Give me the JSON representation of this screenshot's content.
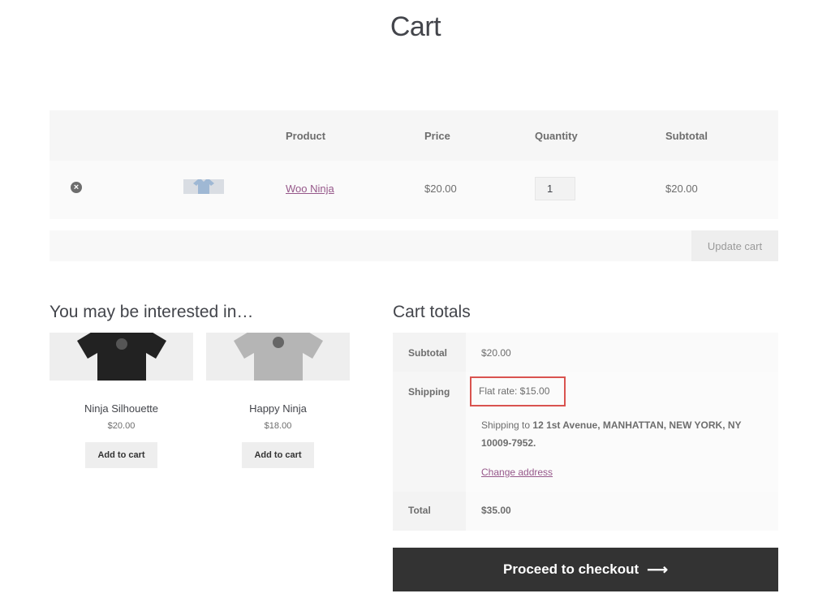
{
  "page": {
    "title": "Cart"
  },
  "cart_table": {
    "headers": {
      "product": "Product",
      "price": "Price",
      "quantity": "Quantity",
      "subtotal": "Subtotal"
    },
    "rows": [
      {
        "remove_icon": "close-circle-icon",
        "product": "Woo Ninja",
        "price": "$20.00",
        "quantity": "1",
        "subtotal": "$20.00"
      }
    ],
    "update_label": "Update cart"
  },
  "cross_sells": {
    "heading": "You may be interested in…",
    "products": [
      {
        "name": "Ninja Silhouette",
        "price": "$20.00",
        "button": "Add to cart",
        "shirt_color": "#222222"
      },
      {
        "name": "Happy Ninja",
        "price": "$18.00",
        "button": "Add to cart",
        "shirt_color": "#b5b5b5"
      }
    ]
  },
  "totals": {
    "heading": "Cart totals",
    "subtotal_label": "Subtotal",
    "subtotal_value": "$20.00",
    "shipping_label": "Shipping",
    "flat_rate": "Flat rate: $15.00",
    "shipping_to_prefix": "Shipping to",
    "shipping_address": "12 1st Avenue, MANHATTAN, NEW YORK, NY 10009-7952.",
    "change_address": "Change address",
    "total_label": "Total",
    "total_value": "$35.00"
  },
  "checkout": {
    "label": "Proceed to checkout",
    "icon": "arrow-right-icon"
  },
  "colors": {
    "accent_link": "#96588a",
    "highlight_border": "#d9534f",
    "checkout_bg": "#333333"
  }
}
